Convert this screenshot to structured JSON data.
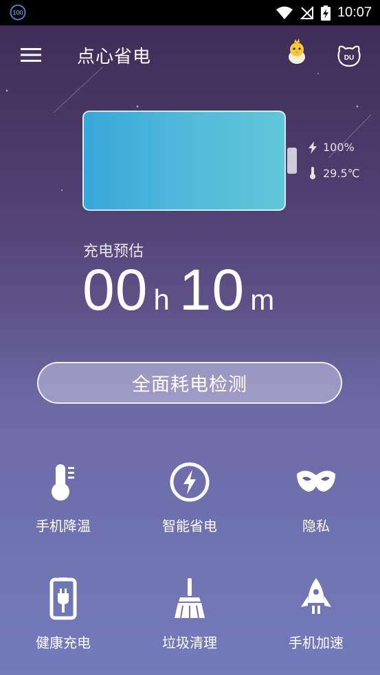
{
  "status_bar": {
    "notification_badge": "100",
    "time": "10:07"
  },
  "app_bar": {
    "title": "点心省电"
  },
  "battery": {
    "level_percent": 100,
    "percent_text": "100%",
    "temperature_text": "29.5℃",
    "fill_color": "#4cb3db"
  },
  "estimate": {
    "label": "充电预估",
    "hours": "00",
    "hours_unit": "h",
    "minutes": "10",
    "minutes_unit": "m"
  },
  "main_button": {
    "label": "全面耗电检测"
  },
  "features": [
    {
      "label": "手机降温",
      "icon": "thermometer-icon"
    },
    {
      "label": "智能省电",
      "icon": "lightning-circle-icon"
    },
    {
      "label": "隐私",
      "icon": "mask-icon"
    },
    {
      "label": "健康充电",
      "icon": "phone-plug-icon"
    },
    {
      "label": "垃圾清理",
      "icon": "broom-icon"
    },
    {
      "label": "手机加速",
      "icon": "rocket-icon"
    }
  ],
  "colors": {
    "background_top": "#3e2a55",
    "background_bottom": "#737bbb",
    "battery_fill": "#4cb3db"
  }
}
